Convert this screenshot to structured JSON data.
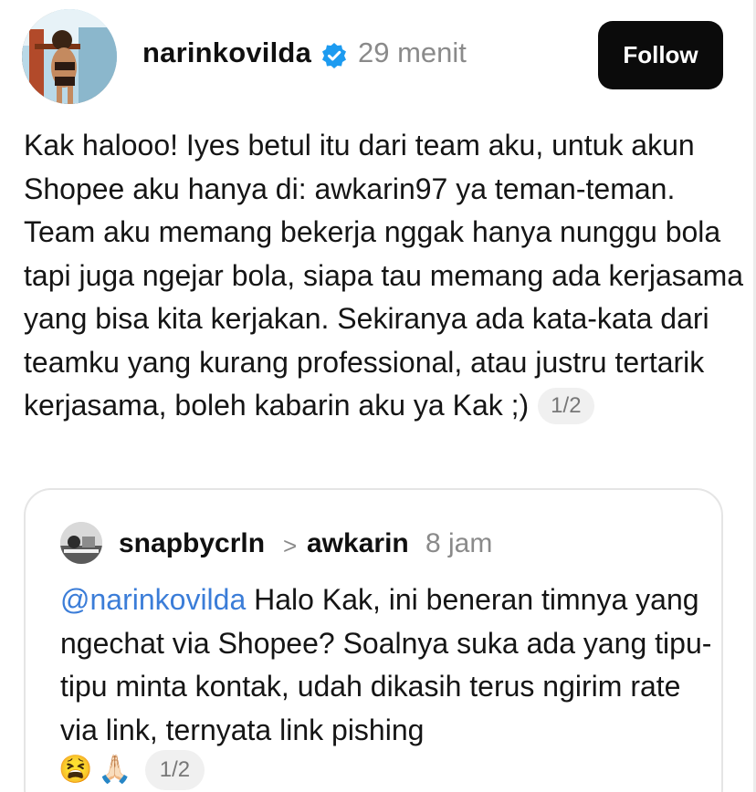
{
  "post": {
    "username": "narinkovilda",
    "timestamp": "29 menit",
    "follow_label": "Follow",
    "body": "Kak halooo! Iyes betul itu dari team aku, untuk akun Shopee aku hanya di: awkarin97 ya teman-teman. Team aku memang bekerja nggak hanya nunggu bola tapi juga ngejar bola, siapa tau memang ada kerjasama yang bisa kita kerjakan. Sekiranya ada kata-kata dari teamku yang kurang professional, atau justru tertarik kerjasama, boleh kabarin aku ya Kak ;)",
    "page_indicator": "1/2",
    "icons": {
      "avatar": "profile-photo",
      "verified": "verified-badge-icon"
    },
    "colors": {
      "follow_bg": "#0b0b0b",
      "verified": "#1d9bf0",
      "mention": "#3b7dd8"
    }
  },
  "quote": {
    "username": "snapbycrln",
    "separator": ">",
    "reply_to": "awkarin",
    "timestamp": "8 jam",
    "mention": "@narinkovilda",
    "body": "Halo Kak, ini beneran timnya yang ngechat via Shopee? Soalnya suka ada yang tipu-tipu minta kontak, udah dikasih terus ngirim rate via link, ternyata link pishing",
    "emojis": [
      "😫",
      "🙏🏻"
    ],
    "page_indicator": "1/2"
  }
}
